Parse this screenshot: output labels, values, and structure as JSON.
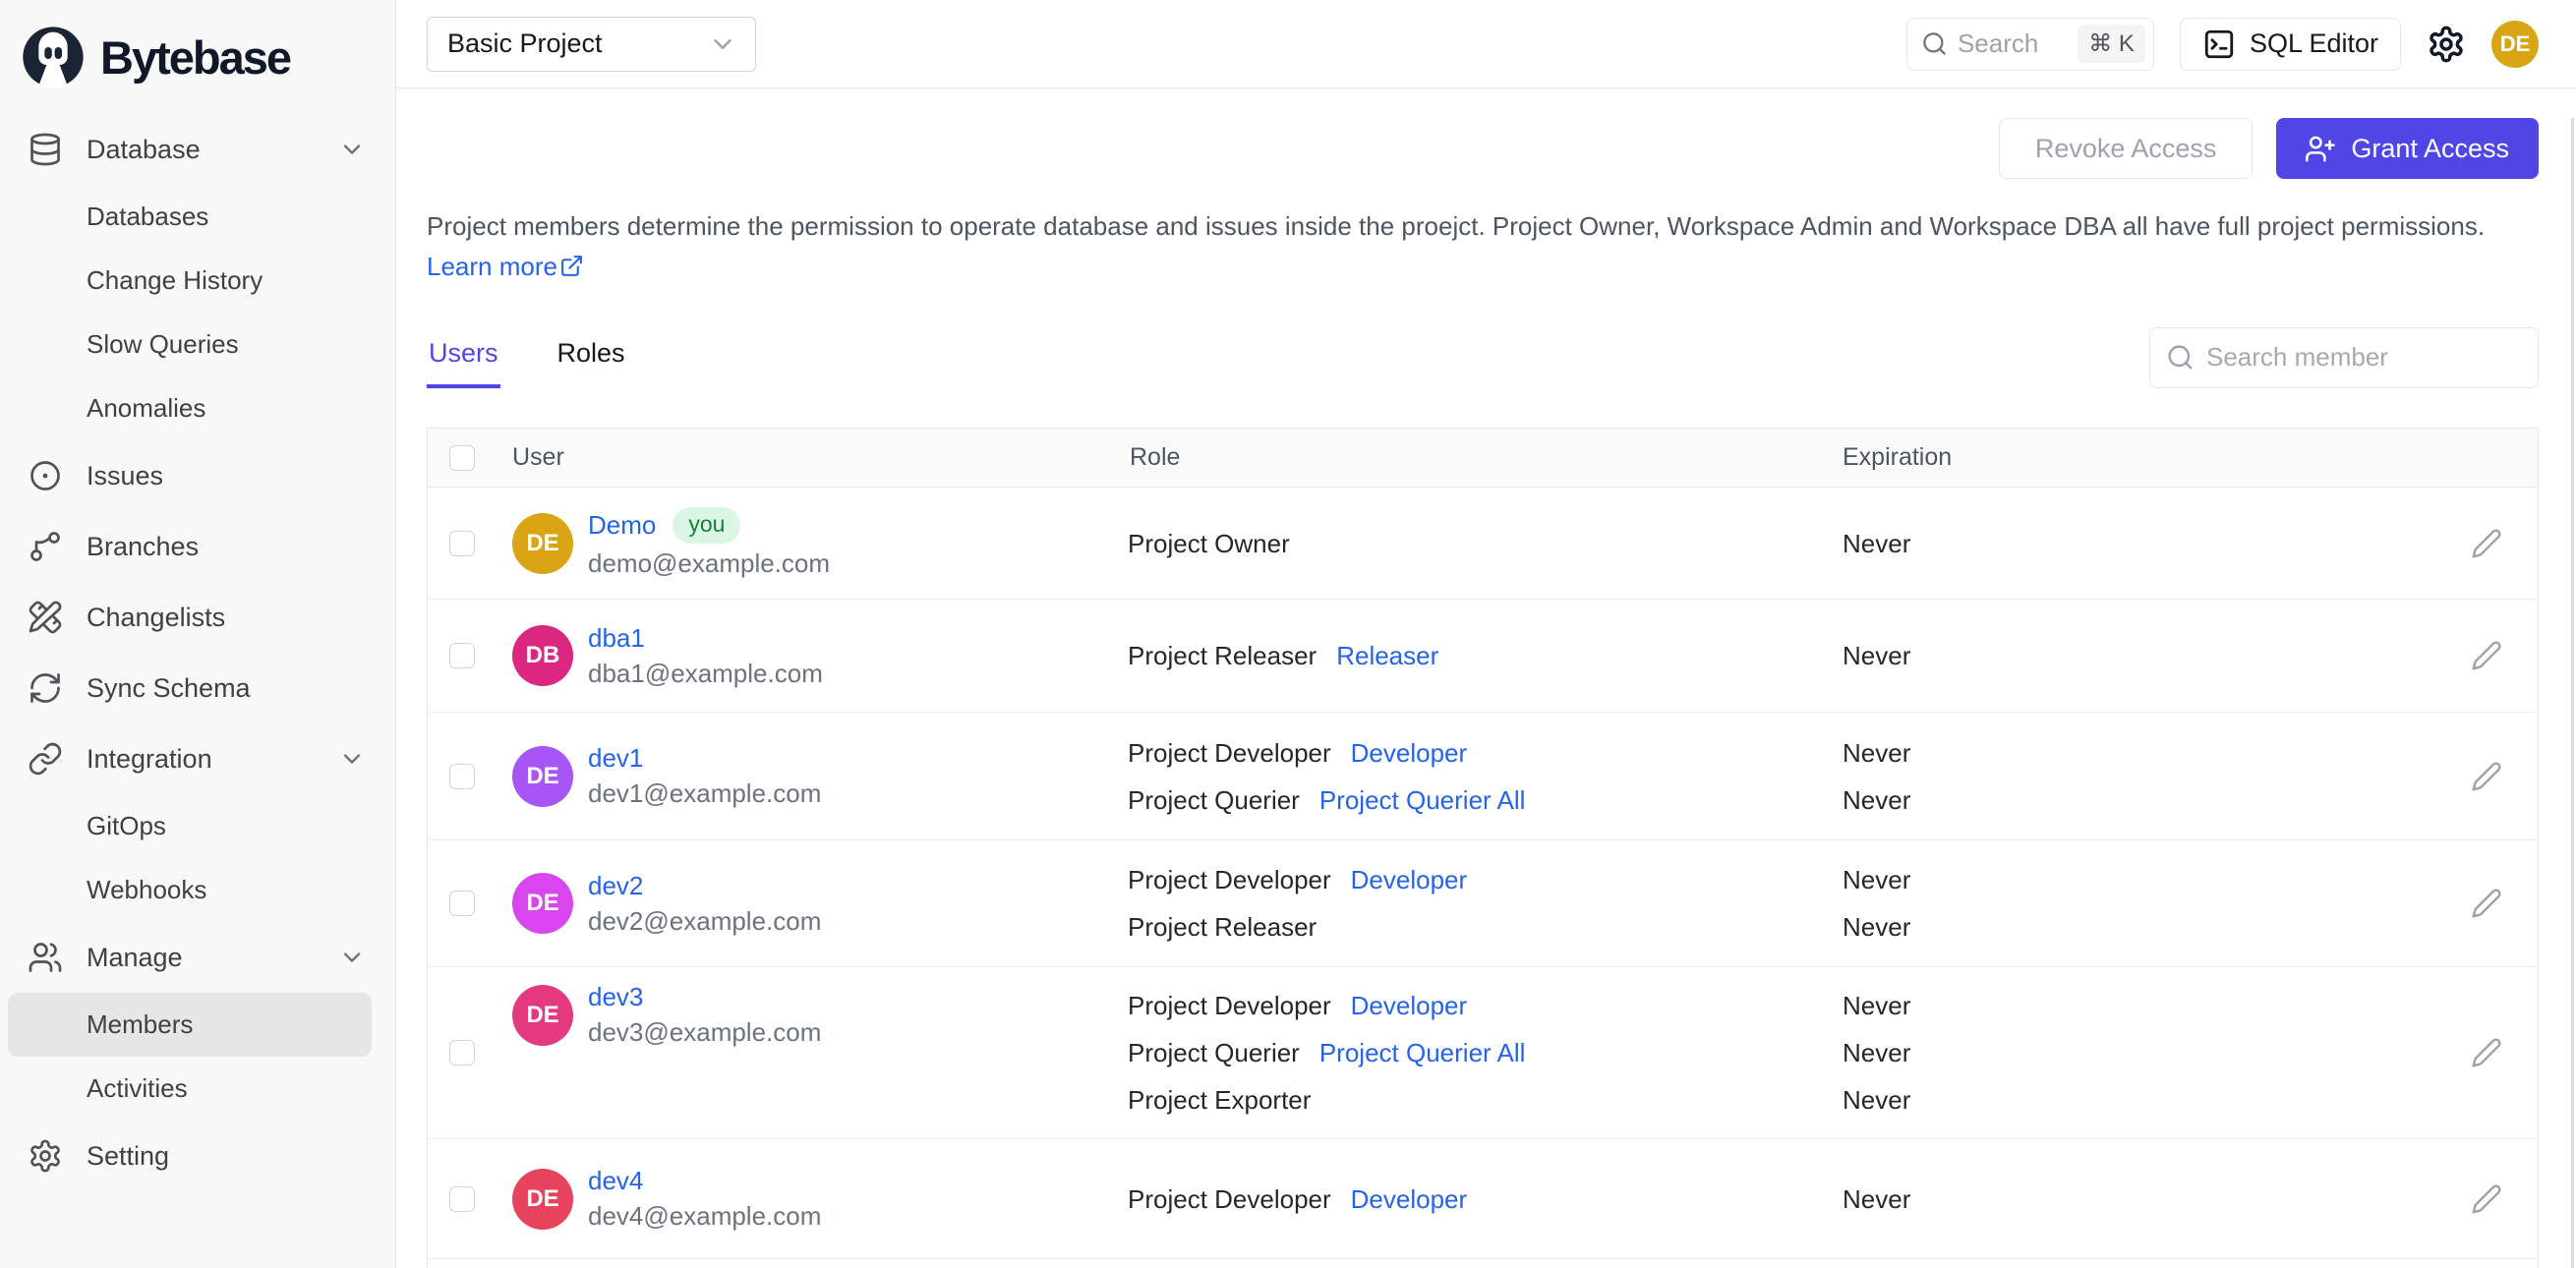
{
  "brand": {
    "name": "Bytebase"
  },
  "colors": {
    "accent": "#4f46e5",
    "link": "#2563eb",
    "sidebar_bg": "#f8f8f8",
    "badge_you_bg": "#d9f7e4",
    "badge_you_text": "#17803d",
    "topbar_avatar": "#d9a514"
  },
  "topbar": {
    "project_selector": "Basic Project",
    "search_placeholder": "Search",
    "search_shortcut": "⌘ K",
    "sql_editor_label": "SQL Editor",
    "avatar_initials": "DE"
  },
  "sidebar": {
    "items": [
      {
        "label": "Database"
      },
      {
        "label": "Databases"
      },
      {
        "label": "Change History"
      },
      {
        "label": "Slow Queries"
      },
      {
        "label": "Anomalies"
      },
      {
        "label": "Issues"
      },
      {
        "label": "Branches"
      },
      {
        "label": "Changelists"
      },
      {
        "label": "Sync Schema"
      },
      {
        "label": "Integration"
      },
      {
        "label": "GitOps"
      },
      {
        "label": "Webhooks"
      },
      {
        "label": "Manage"
      },
      {
        "label": "Members"
      },
      {
        "label": "Activities"
      },
      {
        "label": "Setting"
      }
    ]
  },
  "page": {
    "revoke_label": "Revoke Access",
    "grant_label": "Grant Access",
    "description": "Project members determine the permission to operate database and issues inside the proejct. Project Owner, Workspace Admin and Workspace DBA all have full project permissions.",
    "learn_more_label": "Learn more",
    "tabs": {
      "users": "Users",
      "roles": "Roles"
    },
    "member_search_placeholder": "Search member",
    "table_headers": {
      "user": "User",
      "role": "Role",
      "expiration": "Expiration"
    },
    "members": [
      {
        "initials": "DE",
        "avatar_color": "#d9a514",
        "name": "Demo",
        "badge": "you",
        "email": "demo@example.com",
        "roles": [
          {
            "name": "Project Owner",
            "link": "",
            "expiration": "Never"
          }
        ]
      },
      {
        "initials": "DB",
        "avatar_color": "#db2780",
        "name": "dba1",
        "email": "dba1@example.com",
        "roles": [
          {
            "name": "Project Releaser",
            "link": "Releaser",
            "expiration": "Never"
          }
        ]
      },
      {
        "initials": "DE",
        "avatar_color": "#a855f7",
        "name": "dev1",
        "email": "dev1@example.com",
        "roles": [
          {
            "name": "Project Developer",
            "link": "Developer",
            "expiration": "Never"
          },
          {
            "name": "Project Querier",
            "link": "Project Querier All",
            "expiration": "Never"
          }
        ]
      },
      {
        "initials": "DE",
        "avatar_color": "#d946ef",
        "name": "dev2",
        "email": "dev2@example.com",
        "roles": [
          {
            "name": "Project Developer",
            "link": "Developer",
            "expiration": "Never"
          },
          {
            "name": "Project Releaser",
            "link": "",
            "expiration": "Never"
          }
        ]
      },
      {
        "initials": "DE",
        "avatar_color": "#e5397f",
        "name": "dev3",
        "email": "dev3@example.com",
        "roles": [
          {
            "name": "Project Developer",
            "link": "Developer",
            "expiration": "Never"
          },
          {
            "name": "Project Querier",
            "link": "Project Querier All",
            "expiration": "Never"
          },
          {
            "name": "Project Exporter",
            "link": "",
            "expiration": "Never"
          }
        ]
      },
      {
        "initials": "DE",
        "avatar_color": "#e8435c",
        "name": "dev4",
        "email": "dev4@example.com",
        "roles": [
          {
            "name": "Project Developer",
            "link": "Developer",
            "expiration": "Never"
          }
        ]
      }
    ]
  }
}
